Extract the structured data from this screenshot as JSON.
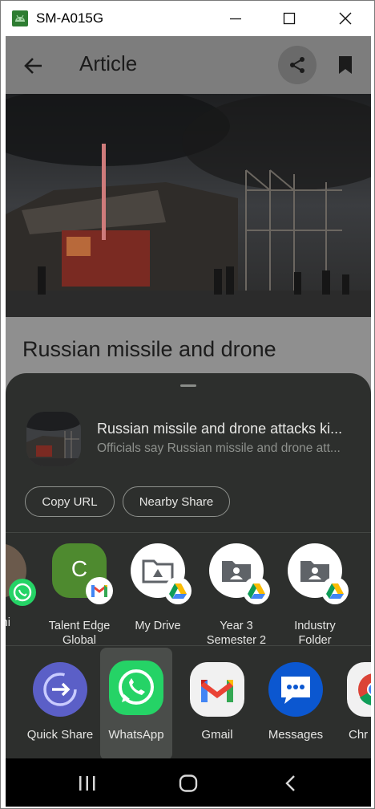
{
  "window": {
    "title": "SM-A015G"
  },
  "appbar": {
    "title": "Article"
  },
  "article": {
    "title": "Russian missile and drone"
  },
  "share_sheet": {
    "preview_title": "Russian missile and drone attacks ki...",
    "preview_subtitle": "Officials say Russian missile and drone att...",
    "chips": [
      "Copy URL",
      "Nearby Share"
    ],
    "direct_targets": [
      {
        "label": "ni",
        "avatar_text": ""
      },
      {
        "label": "Talent Edge Global",
        "line1": "Talent Edge",
        "line2": "Global",
        "avatar_text": "C",
        "avatar_color": "#4e8a2f",
        "badge": "gmail-icon"
      },
      {
        "label": "My Drive",
        "line1": "My Drive",
        "line2": "",
        "badge": "google-drive-icon"
      },
      {
        "label": "Year 3 Semester 2",
        "line1": "Year 3",
        "line2": "Semester 2",
        "badge": "google-drive-icon"
      },
      {
        "label": "Industry Folder",
        "line1": "Industry",
        "line2": "Folder",
        "badge": "google-drive-icon"
      }
    ],
    "apps": [
      {
        "label": "Quick Share",
        "icon": "quick-share-icon"
      },
      {
        "label": "WhatsApp",
        "icon": "whatsapp-icon",
        "selected": true
      },
      {
        "label": "Gmail",
        "icon": "gmail-icon"
      },
      {
        "label": "Messages",
        "icon": "messages-icon"
      },
      {
        "label": "Chr",
        "icon": "chrome-icon"
      }
    ]
  },
  "colors": {
    "sheet_bg": "#2d2f2d",
    "whatsapp_green": "#25d366",
    "quick_share_purple": "#5b5fc7",
    "messages_blue": "#0b57d0"
  }
}
